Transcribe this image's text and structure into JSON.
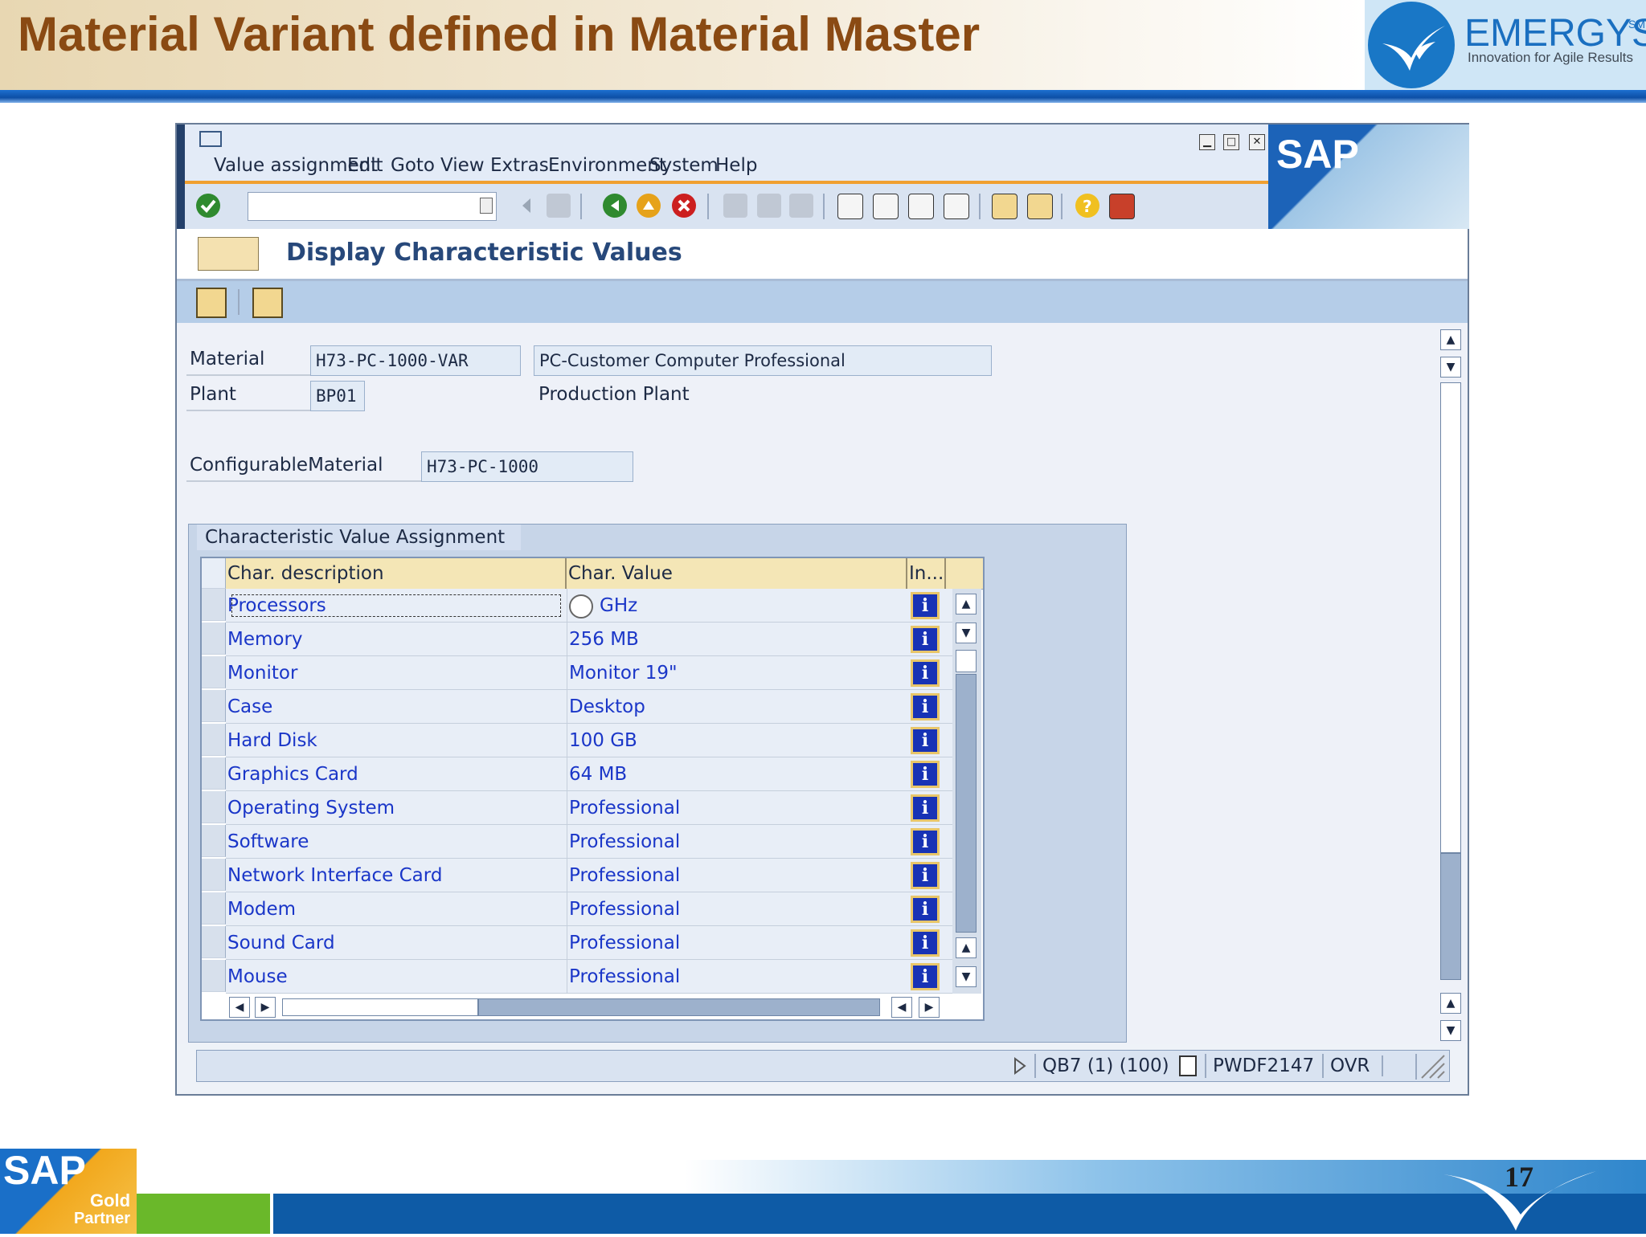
{
  "slide": {
    "title": "Material Variant defined in Material Master",
    "logo_name": "EMERGYS",
    "logo_sm": "SM",
    "logo_tagline": "Innovation for Agile Results",
    "page_number": "17",
    "footer_logo": "SAP",
    "footer_gold": "Gold",
    "footer_partner": "Partner"
  },
  "window": {
    "sap_logo": "SAP",
    "menu": [
      "Value assignment",
      "Edit",
      "Goto",
      "View",
      "Extras",
      "Environment",
      "System",
      "Help"
    ],
    "screen_title": "Display Characteristic Values",
    "command_field": {
      "value": "",
      "placeholder": ""
    }
  },
  "header_fields": {
    "material_label": "Material",
    "material_value": "H73-PC-1000-VAR",
    "material_desc": "PC-Customer Computer Professional",
    "plant_label": "Plant",
    "plant_value": "BP01",
    "plant_desc": "Production Plant",
    "config_label": "ConfigurableMaterial",
    "config_value": "H73-PC-1000"
  },
  "char_tab": {
    "tab_label": "Characteristic Value Assignment",
    "columns": [
      "Char. description",
      "Char. Value",
      "In..."
    ],
    "rows": [
      {
        "description": "Processors",
        "value": "GHz"
      },
      {
        "description": "Memory",
        "value": "256 MB"
      },
      {
        "description": "Monitor",
        "value": "Monitor 19\""
      },
      {
        "description": "Case",
        "value": "Desktop"
      },
      {
        "description": "Hard Disk",
        "value": "100 GB"
      },
      {
        "description": "Graphics Card",
        "value": "64 MB"
      },
      {
        "description": "Operating System",
        "value": "Professional"
      },
      {
        "description": "Software",
        "value": "Professional"
      },
      {
        "description": "Network Interface Card",
        "value": "Professional"
      },
      {
        "description": "Modem",
        "value": "Professional"
      },
      {
        "description": "Sound Card",
        "value": "Professional"
      },
      {
        "description": "Mouse",
        "value": "Professional"
      }
    ],
    "info_glyph": "i"
  },
  "status_bar": {
    "system": "QB7 (1) (100)",
    "server": "PWDF2147",
    "mode": "OVR"
  },
  "colors": {
    "title_brown": "#8a4a13",
    "sap_blue": "#1c63b8",
    "link_blue": "#1a36c8",
    "header_yellow": "#f4e6b6"
  }
}
